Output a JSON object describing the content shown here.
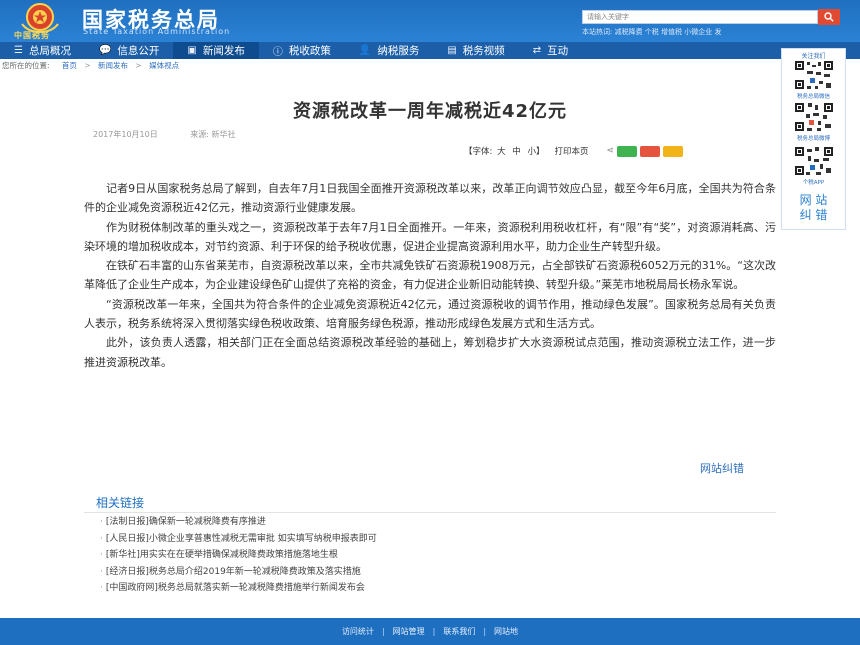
{
  "header": {
    "site_title": "国家税务总局",
    "site_subtitle": "State Taxation Administration",
    "emblem_text": "中国税务",
    "search_placeholder": "请输入关键字",
    "hotwords": "本站热词:  减税降费  个税  增值税  小微企业  发"
  },
  "nav": [
    {
      "label": "总局概况",
      "icon": "menu-icon",
      "glyph": "☰"
    },
    {
      "label": "信息公开",
      "icon": "chat-icon",
      "glyph": "💬"
    },
    {
      "label": "新闻发布",
      "icon": "tv-icon",
      "glyph": "▣",
      "active": true
    },
    {
      "label": "税收政策",
      "icon": "info-icon",
      "glyph": "ⓘ"
    },
    {
      "label": "纳税服务",
      "icon": "person-icon",
      "glyph": "👤"
    },
    {
      "label": "税务视频",
      "icon": "video-icon",
      "glyph": "▤"
    },
    {
      "label": "互动",
      "icon": "refresh-icon",
      "glyph": "⇄"
    }
  ],
  "breadcrumb": {
    "prefix": "您所在的位置:",
    "items": [
      "首页",
      "新闻发布",
      "媒体视点"
    ]
  },
  "article": {
    "title": "资源税改革一周年减税近42亿元",
    "date": "2017年10月10日",
    "source": "来源:  新华社",
    "font_size_label": "【字体:",
    "font_large": "大",
    "font_medium": "中",
    "font_small": "小】",
    "print_label": "打印本页",
    "paragraphs": [
      "记者9日从国家税务总局了解到，自去年7月1日我国全面推开资源税改革以来，改革正向调节效应凸显，截至今年6月底，全国共为符合条件的企业减免资源税近42亿元，推动资源行业健康发展。",
      "作为财税体制改革的重头戏之一，资源税改革于去年7月1日全面推开。一年来，资源税利用税收杠杆，有“限”有“奖”，对资源消耗高、污染环境的增加税收成本，对节约资源、利于环保的给予税收优惠，促进企业提高资源利用水平，助力企业生产转型升级。",
      "在铁矿石丰富的山东省莱芜市，自资源税改革以来，全市共减免铁矿石资源税1908万元，占全部铁矿石资源税6052万元的31%。“这次改革降低了企业生产成本，为企业建设绿色矿山提供了充裕的资金，有力促进企业新旧动能转换、转型升级。”莱芜市地税局局长杨永军说。",
      "“资源税改革一年来，全国共为符合条件的企业减免资源税近42亿元，通过资源税收的调节作用，推动绿色发展”。国家税务总局有关负责人表示，税务系统将深入贯彻落实绿色税收政策、培育服务绿色税源，推动形成绿色发展方式和生活方式。",
      "此外，该负责人透露，相关部门正在全面总结资源税改革经验的基础上，筹划稳步扩大水资源税试点范围，推动资源税立法工作，进一步推进资源税改革。"
    ],
    "correction_link": "网站纠错"
  },
  "related": {
    "title": "相关链接",
    "items": [
      "[法制日报]确保新一轮减税降费有序推进",
      "[人民日报]小微企业享普惠性减税无需审批 如实填写纳税申报表即可",
      "[新华社]用实实在在硬举措确保减税降费政策措施落地生根",
      "[经济日报]税务总局介绍2019年新一轮减税降费政策及落实措施",
      "[中国政府网]税务总局就落实新一轮减税降费措施举行新闻发布会"
    ]
  },
  "footer": {
    "links": [
      "访问统计",
      "网站管理",
      "联系我们",
      "网站地"
    ]
  },
  "side_panel": {
    "top_label": "关注我们",
    "qr_labels": [
      "税务总局微信",
      "税务总局微博",
      "个税APP"
    ],
    "correction_badge_line1": "网 站",
    "correction_badge_line2": "纠 错"
  },
  "colors": {
    "brand_blue": "#1f6fc0",
    "nav_blue": "#1c5fa8",
    "link_blue": "#2b6dbf",
    "search_red": "#e04a32"
  }
}
